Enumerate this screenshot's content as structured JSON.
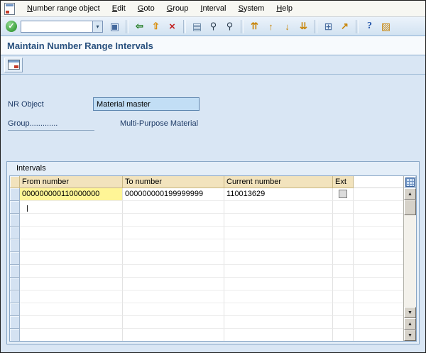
{
  "menubar": {
    "items": [
      {
        "label": "Number range object",
        "name": "menu-item-number-range-object"
      },
      {
        "label": "Edit",
        "name": "menu-item-edit"
      },
      {
        "label": "Goto",
        "name": "menu-item-goto"
      },
      {
        "label": "Group",
        "name": "menu-item-group"
      },
      {
        "label": "Interval",
        "name": "menu-item-interval"
      },
      {
        "label": "System",
        "name": "menu-item-system"
      },
      {
        "label": "Help",
        "name": "menu-item-help"
      }
    ]
  },
  "toolbar": {
    "enter": {
      "glyph": "✓"
    },
    "command": {
      "value": "",
      "dropdown_glyph": "▾"
    },
    "buttons": [
      {
        "name": "save-icon",
        "glyph": "▣",
        "inter": "true"
      },
      {
        "name": "toolbar-separator",
        "glyph": "",
        "inter": "false"
      },
      {
        "name": "back-icon",
        "glyph": "⇦",
        "inter": "true"
      },
      {
        "name": "exit-icon",
        "glyph": "⇧",
        "inter": "true"
      },
      {
        "name": "cancel-icon",
        "glyph": "×",
        "inter": "true"
      },
      {
        "name": "toolbar-separator",
        "glyph": "",
        "inter": "false"
      },
      {
        "name": "print-icon",
        "glyph": "▤",
        "inter": "true"
      },
      {
        "name": "find-icon",
        "glyph": "⚲",
        "inter": "true"
      },
      {
        "name": "find-next-icon",
        "glyph": "⚲",
        "inter": "true"
      },
      {
        "name": "toolbar-separator",
        "glyph": "",
        "inter": "false"
      },
      {
        "name": "first-page-icon",
        "glyph": "⇈",
        "inter": "true"
      },
      {
        "name": "previous-page-icon",
        "glyph": "↑",
        "inter": "true"
      },
      {
        "name": "next-page-icon",
        "glyph": "↓",
        "inter": "true"
      },
      {
        "name": "last-page-icon",
        "glyph": "⇊",
        "inter": "true"
      },
      {
        "name": "toolbar-separator",
        "glyph": "",
        "inter": "false"
      },
      {
        "name": "new-session-icon",
        "glyph": "⊞",
        "inter": "true"
      },
      {
        "name": "create-shortcut-icon",
        "glyph": "↗",
        "inter": "true"
      },
      {
        "name": "toolbar-separator",
        "glyph": "",
        "inter": "false"
      },
      {
        "name": "help-icon",
        "glyph": "?",
        "inter": "true"
      },
      {
        "name": "customize-layout-icon",
        "glyph": "▨",
        "inter": "true"
      }
    ]
  },
  "title": "Maintain Number Range Intervals",
  "form": {
    "nr_object_label": "NR Object",
    "nr_object_value": "Material master",
    "group_label": "Group.............",
    "group_value": "Multi-Purpose Material"
  },
  "intervals": {
    "caption": "Intervals",
    "columns": [
      {
        "label": "From number"
      },
      {
        "label": "To number"
      },
      {
        "label": "Current number"
      },
      {
        "label": "Ext"
      }
    ],
    "rows": [
      {
        "from": "000000000110000000",
        "to": "000000000199999999",
        "current": "110013629",
        "ext": false
      }
    ]
  },
  "scrollbar": {
    "up": "▲",
    "down": "▼",
    "page_up": "▲",
    "page_down": "▼"
  },
  "colors": {
    "title_text": "#28507e",
    "content_bg": "#d9e6f4",
    "table_header_bg": "#f2e3bd",
    "highlight_cell_bg": "#fff596",
    "field_bg": "#c2def5",
    "toolbar_bg": "#dce9f6"
  }
}
